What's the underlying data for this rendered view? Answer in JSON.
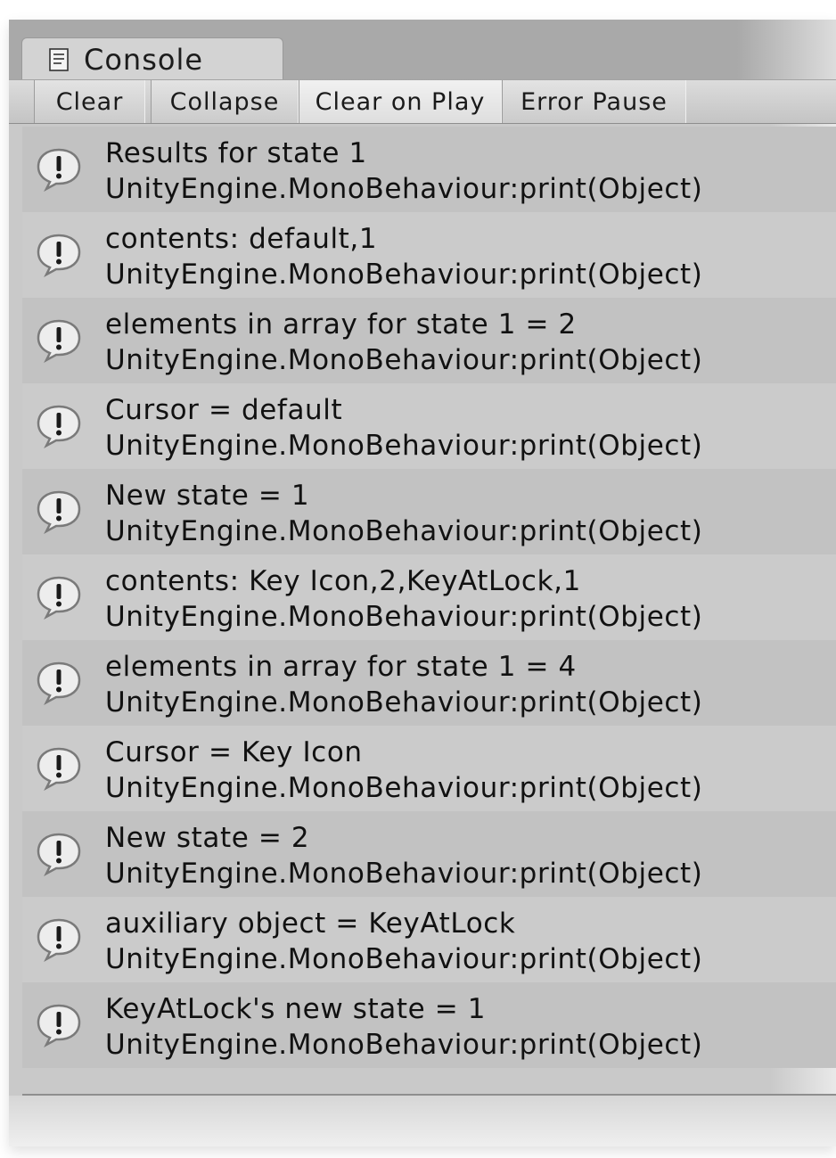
{
  "window": {
    "tab_label": "Console",
    "tab_icon": "console-document-icon"
  },
  "toolbar": {
    "buttons": [
      {
        "label": "Clear",
        "active": false
      },
      {
        "label": "Collapse",
        "active": false
      },
      {
        "label": "Clear on Play",
        "active": true
      },
      {
        "label": "Error Pause",
        "active": false
      }
    ]
  },
  "log": {
    "icon": "warning-speech-bubble-icon",
    "entries": [
      {
        "message": "Results for state 1",
        "source": "UnityEngine.MonoBehaviour:print(Object)"
      },
      {
        "message": "contents: default,1",
        "source": "UnityEngine.MonoBehaviour:print(Object)"
      },
      {
        "message": "elements in array for state 1 = 2",
        "source": "UnityEngine.MonoBehaviour:print(Object)"
      },
      {
        "message": "Cursor = default",
        "source": "UnityEngine.MonoBehaviour:print(Object)"
      },
      {
        "message": "New state = 1",
        "source": "UnityEngine.MonoBehaviour:print(Object)"
      },
      {
        "message": "contents: Key Icon,2,KeyAtLock,1",
        "source": "UnityEngine.MonoBehaviour:print(Object)"
      },
      {
        "message": "elements in array for state 1 = 4",
        "source": "UnityEngine.MonoBehaviour:print(Object)"
      },
      {
        "message": "Cursor = Key Icon",
        "source": "UnityEngine.MonoBehaviour:print(Object)"
      },
      {
        "message": "New state = 2",
        "source": "UnityEngine.MonoBehaviour:print(Object)"
      },
      {
        "message": "auxiliary object = KeyAtLock",
        "source": "UnityEngine.MonoBehaviour:print(Object)"
      },
      {
        "message": "KeyAtLock's new state = 1",
        "source": "UnityEngine.MonoBehaviour:print(Object)"
      }
    ]
  }
}
